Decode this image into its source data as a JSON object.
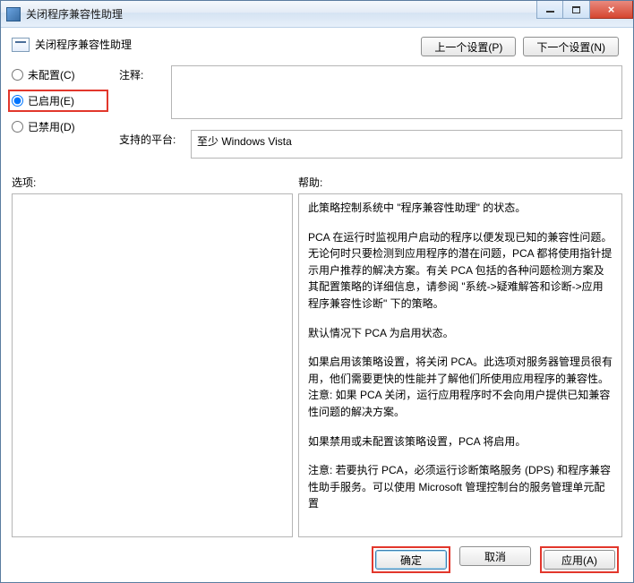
{
  "window": {
    "title": "关闭程序兼容性助理"
  },
  "header": {
    "policy_title": "关闭程序兼容性助理",
    "prev_label": "上一个设置(P)",
    "next_label": "下一个设置(N)"
  },
  "radios": {
    "not_configured": "未配置(C)",
    "enabled": "已启用(E)",
    "disabled": "已禁用(D)"
  },
  "fields": {
    "comment_label": "注释:",
    "comment_value": "",
    "platform_label": "支持的平台:",
    "platform_value": "至少 Windows Vista"
  },
  "sections": {
    "options_label": "选项:",
    "help_label": "帮助:"
  },
  "help": {
    "p1": "此策略控制系统中 \"程序兼容性助理\" 的状态。",
    "p2": "PCA 在运行时监视用户启动的程序以便发现已知的兼容性问题。无论何时只要检测到应用程序的潜在问题，PCA 都将使用指针提示用户推荐的解决方案。有关 PCA 包括的各种问题检测方案及其配置策略的详细信息，请参阅 \"系统->疑难解答和诊断->应用程序兼容性诊断\" 下的策略。",
    "p3": "默认情况下 PCA 为启用状态。",
    "p4": "如果启用该策略设置，将关闭 PCA。此选项对服务器管理员很有用，他们需要更快的性能并了解他们所使用应用程序的兼容性。注意: 如果 PCA 关闭，运行应用程序时不会向用户提供已知兼容性问题的解决方案。",
    "p5": "如果禁用或未配置该策略设置，PCA 将启用。",
    "p6": "注意: 若要执行 PCA，必须运行诊断策略服务 (DPS) 和程序兼容性助手服务。可以使用 Microsoft 管理控制台的服务管理单元配置"
  },
  "footer": {
    "ok": "确定",
    "cancel": "取消",
    "apply": "应用(A)"
  }
}
